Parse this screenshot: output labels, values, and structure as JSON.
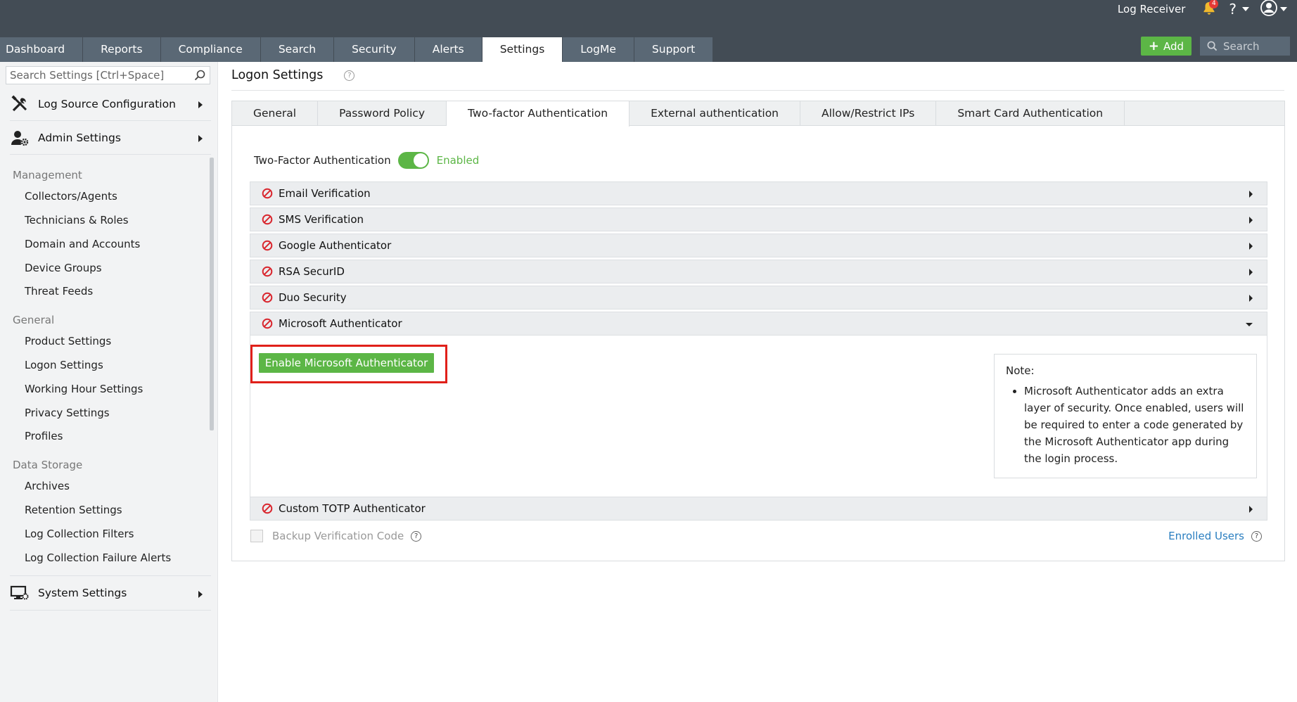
{
  "header": {
    "log_receiver": "Log Receiver",
    "notification_count": "4",
    "help_label": "?",
    "tabs": [
      "Dashboard",
      "Reports",
      "Compliance",
      "Search",
      "Security",
      "Alerts",
      "Settings",
      "LogMe",
      "Support"
    ],
    "active_tab": "Settings",
    "add_label": "Add",
    "search_placeholder": "Search"
  },
  "sidebar": {
    "search_placeholder": "Search Settings [Ctrl+Space]",
    "sections": {
      "log_source": "Log Source Configuration",
      "admin": "Admin Settings",
      "system": "System Settings"
    },
    "groups": {
      "management": {
        "title": "Management",
        "items": [
          "Collectors/Agents",
          "Technicians & Roles",
          "Domain and Accounts",
          "Device Groups",
          "Threat Feeds"
        ]
      },
      "general": {
        "title": "General",
        "items": [
          "Product Settings",
          "Logon Settings",
          "Working Hour Settings",
          "Privacy Settings",
          "Profiles"
        ]
      },
      "data_storage": {
        "title": "Data Storage",
        "items": [
          "Archives",
          "Retention Settings",
          "Log Collection Filters",
          "Log Collection Failure Alerts"
        ]
      }
    }
  },
  "main": {
    "title": "Logon Settings",
    "subtabs": [
      "General",
      "Password Policy",
      "Two-factor Authentication",
      "External authentication",
      "Allow/Restrict IPs",
      "Smart Card Authentication"
    ],
    "active_subtab": "Two-factor Authentication",
    "tfa_label": "Two-Factor Authentication",
    "tfa_status": "Enabled",
    "methods": [
      "Email Verification",
      "SMS Verification",
      "Google Authenticator",
      "RSA SecurID",
      "Duo Security",
      "Microsoft Authenticator",
      "Custom TOTP Authenticator"
    ],
    "expanded_method": "Microsoft Authenticator",
    "enable_button": "Enable Microsoft Authenticator",
    "note_title": "Note:",
    "note_text": "Microsoft Authenticator adds an extra layer of security. Once enabled, users will be required to enter a code generated by the Microsoft Authenticator app during the login process.",
    "backup_label": "Backup Verification Code",
    "enrolled_users": "Enrolled Users"
  },
  "colors": {
    "header_bg": "#434c55",
    "tab_bg": "#5a6875",
    "accent_green": "#5cb646",
    "highlight_red": "#e0201a",
    "link_blue": "#2a7ec0"
  }
}
